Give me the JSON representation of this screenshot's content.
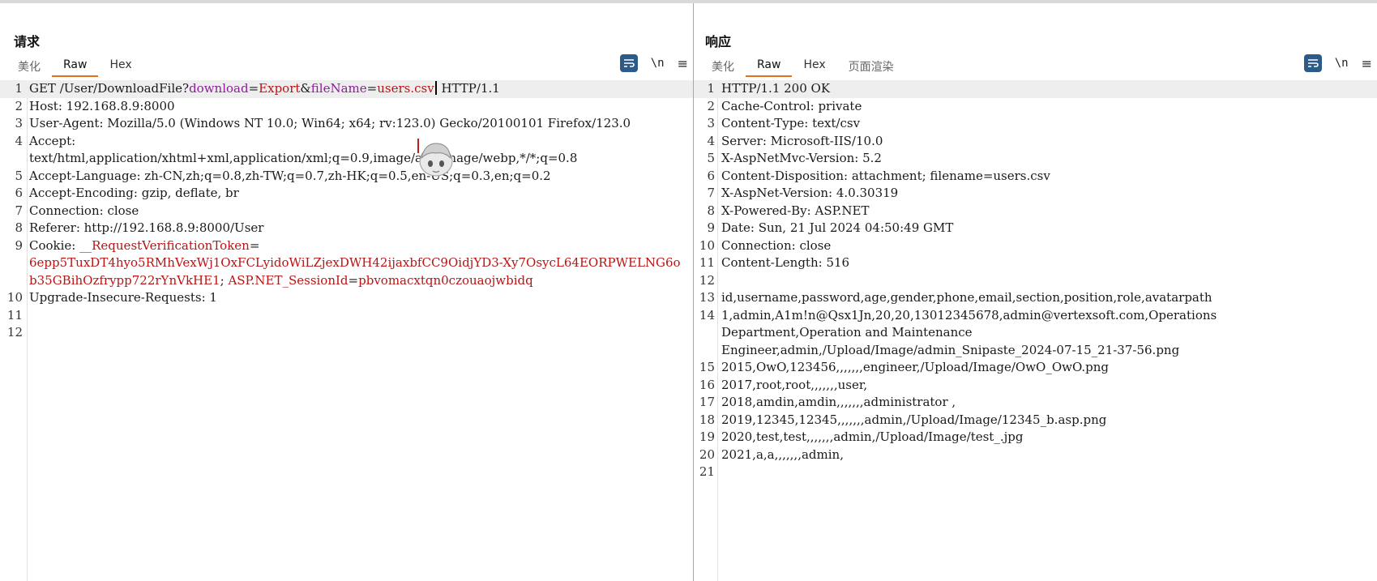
{
  "layout_toggles": [
    {
      "name": "side-by-side",
      "active": true
    },
    {
      "name": "top-bottom",
      "active": false
    },
    {
      "name": "single",
      "active": false
    }
  ],
  "request": {
    "title": "请求",
    "tabs": [
      "美化",
      "Raw",
      "Hex"
    ],
    "active_tab": "Raw",
    "toolbar": {
      "newline_label": "\\n",
      "menu_label": "≡"
    },
    "line_numbers": [
      "1",
      "2",
      "3",
      "",
      "4",
      "",
      "",
      "5",
      "6",
      "7",
      "8",
      "9",
      "",
      "",
      "10",
      "11",
      "12"
    ],
    "lines": {
      "l1": {
        "method": "GET ",
        "path": "/User/DownloadFile?",
        "p1": "download",
        "eq1": "=",
        "v1": "Export",
        "amp": "&",
        "p2": "fileName",
        "eq2": "=",
        "v2": "users.csv",
        "proto": " HTTP/1.1"
      },
      "l2": {
        "key": "Host:",
        "value": " 192.168.8.9:8000"
      },
      "l3": {
        "key": "User-Agent:",
        "value": " Mozilla/5.0 (Windows NT 10.0; Win64; x64; rv:123.0) Gecko/20100101 Firefox/123.0"
      },
      "l4": {
        "key": "Accept:",
        "value": "text/html,application/xhtml+xml,application/xml;q=0.9,image/avif,image/webp,*/*;q=0.8"
      },
      "l5": {
        "key": "Accept-Language:",
        "value": " zh-CN,zh;q=0.8,zh-TW;q=0.7,zh-HK;q=0.5,en-US;q=0.3,en;q=0.2"
      },
      "l6": {
        "key": "Accept-Encoding:",
        "value": " gzip, deflate, br"
      },
      "l7": {
        "key": "Connection:",
        "value": " close"
      },
      "l8": {
        "key": "Referer:",
        "value": " http://192.168.8.9:8000/User"
      },
      "l9": {
        "key": "Cookie:",
        "c1k": " __RequestVerificationToken",
        "c1eq": "=",
        "c1v": "6epp5TuxDT4hyo5RMhVexWj1OxFCLyidoWiLZjexDWH42ijaxbfCC9OidjYD3-Xy7OsycL64EORPWELNG6ob35GBihOzfrypp722rYnVkHE1",
        "sep": "; ",
        "c2k": "ASP.NET_SessionId",
        "c2eq": "=",
        "c2v": "pbvomacxtqn0czouaojwbidq"
      },
      "l10": {
        "key": "Upgrade-Insecure-Requests:",
        "value": " 1"
      }
    }
  },
  "response": {
    "title": "响应",
    "tabs": [
      "美化",
      "Raw",
      "Hex",
      "页面渲染"
    ],
    "active_tab": "Raw",
    "toolbar": {
      "newline_label": "\\n",
      "menu_label": "≡"
    },
    "lines": [
      {
        "n": "1",
        "text": "HTTP/1.1 200 OK"
      },
      {
        "n": "2",
        "text": "Cache-Control: private"
      },
      {
        "n": "3",
        "text": "Content-Type: text/csv"
      },
      {
        "n": "4",
        "text": "Server: Microsoft-IIS/10.0"
      },
      {
        "n": "5",
        "text": "X-AspNetMvc-Version: 5.2"
      },
      {
        "n": "6",
        "text": "Content-Disposition: attachment; filename=users.csv"
      },
      {
        "n": "7",
        "text": "X-AspNet-Version: 4.0.30319"
      },
      {
        "n": "8",
        "text": "X-Powered-By: ASP.NET"
      },
      {
        "n": "9",
        "text": "Date: Sun, 21 Jul 2024 04:50:49 GMT"
      },
      {
        "n": "10",
        "text": "Connection: close"
      },
      {
        "n": "11",
        "text": "Content-Length: 516"
      },
      {
        "n": "12",
        "text": ""
      },
      {
        "n": "13",
        "text": "id,username,password,age,gender,phone,email,section,position,role,avatarpath"
      },
      {
        "n": "14",
        "text": "1,admin,A1m!n@Qsx1Jn,20,20,13012345678,admin@vertexsoft.com,Operations"
      },
      {
        "n": "",
        "text": "Department,Operation and Maintenance"
      },
      {
        "n": "",
        "text": "Engineer,admin,/Upload/Image/admin_Snipaste_2024-07-15_21-37-56.png"
      },
      {
        "n": "15",
        "text": "2015,OwO,123456,,,,,,,engineer,/Upload/Image/OwO_OwO.png"
      },
      {
        "n": "16",
        "text": "2017,root,root,,,,,,,user,"
      },
      {
        "n": "17",
        "text": "2018,amdin,amdin,,,,,,,administrator ,"
      },
      {
        "n": "18",
        "text": "2019,12345,12345,,,,,,,admin,/Upload/Image/12345_b.asp.png"
      },
      {
        "n": "19",
        "text": "2020,test,test,,,,,,,admin,/Upload/Image/test_.jpg"
      },
      {
        "n": "20",
        "text": "2021,a,a,,,,,,,admin,"
      },
      {
        "n": "21",
        "text": ""
      }
    ]
  }
}
